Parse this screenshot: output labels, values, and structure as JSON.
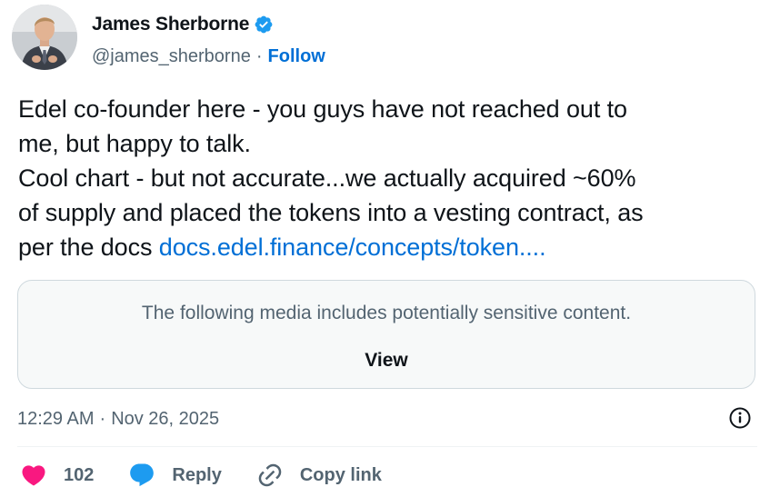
{
  "author": {
    "display_name": "James Sherborne",
    "handle": "@james_sherborne",
    "separator": "·",
    "follow_label": "Follow",
    "verified_icon": "verified-badge-icon"
  },
  "tweet": {
    "lines": [
      "Edel co-founder here - you guys have not reached out to",
      "me, but happy to talk.",
      "Cool chart - but not accurate...we actually acquired ~60%",
      "of supply and placed the tokens into a vesting contract, as"
    ],
    "last_line_prefix": "per the docs ",
    "link_text": "docs.edel.finance/concepts/token....",
    "link_color": "#006fd6"
  },
  "media": {
    "warning_text": "The following media includes potentially sensitive content.",
    "view_label": "View"
  },
  "meta": {
    "time": "12:29 AM",
    "separator": "·",
    "date": "Nov 26, 2025",
    "info_icon": "info-icon"
  },
  "actions": {
    "like_count": "102",
    "reply_label": "Reply",
    "copy_link_label": "Copy link",
    "like_color": "#f91880",
    "reply_color": "#1d9bf0"
  }
}
